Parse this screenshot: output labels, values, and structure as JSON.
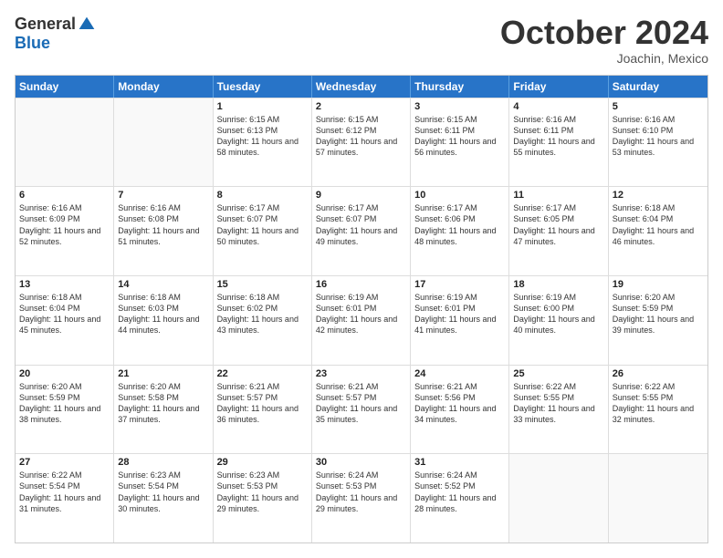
{
  "logo": {
    "general": "General",
    "blue": "Blue"
  },
  "title": "October 2024",
  "location": "Joachin, Mexico",
  "days": [
    "Sunday",
    "Monday",
    "Tuesday",
    "Wednesday",
    "Thursday",
    "Friday",
    "Saturday"
  ],
  "weeks": [
    [
      {
        "day": "",
        "sunrise": "",
        "sunset": "",
        "daylight": "",
        "empty": true
      },
      {
        "day": "",
        "sunrise": "",
        "sunset": "",
        "daylight": "",
        "empty": true
      },
      {
        "day": "1",
        "sunrise": "Sunrise: 6:15 AM",
        "sunset": "Sunset: 6:13 PM",
        "daylight": "Daylight: 11 hours and 58 minutes."
      },
      {
        "day": "2",
        "sunrise": "Sunrise: 6:15 AM",
        "sunset": "Sunset: 6:12 PM",
        "daylight": "Daylight: 11 hours and 57 minutes."
      },
      {
        "day": "3",
        "sunrise": "Sunrise: 6:15 AM",
        "sunset": "Sunset: 6:11 PM",
        "daylight": "Daylight: 11 hours and 56 minutes."
      },
      {
        "day": "4",
        "sunrise": "Sunrise: 6:16 AM",
        "sunset": "Sunset: 6:11 PM",
        "daylight": "Daylight: 11 hours and 55 minutes."
      },
      {
        "day": "5",
        "sunrise": "Sunrise: 6:16 AM",
        "sunset": "Sunset: 6:10 PM",
        "daylight": "Daylight: 11 hours and 53 minutes."
      }
    ],
    [
      {
        "day": "6",
        "sunrise": "Sunrise: 6:16 AM",
        "sunset": "Sunset: 6:09 PM",
        "daylight": "Daylight: 11 hours and 52 minutes."
      },
      {
        "day": "7",
        "sunrise": "Sunrise: 6:16 AM",
        "sunset": "Sunset: 6:08 PM",
        "daylight": "Daylight: 11 hours and 51 minutes."
      },
      {
        "day": "8",
        "sunrise": "Sunrise: 6:17 AM",
        "sunset": "Sunset: 6:07 PM",
        "daylight": "Daylight: 11 hours and 50 minutes."
      },
      {
        "day": "9",
        "sunrise": "Sunrise: 6:17 AM",
        "sunset": "Sunset: 6:07 PM",
        "daylight": "Daylight: 11 hours and 49 minutes."
      },
      {
        "day": "10",
        "sunrise": "Sunrise: 6:17 AM",
        "sunset": "Sunset: 6:06 PM",
        "daylight": "Daylight: 11 hours and 48 minutes."
      },
      {
        "day": "11",
        "sunrise": "Sunrise: 6:17 AM",
        "sunset": "Sunset: 6:05 PM",
        "daylight": "Daylight: 11 hours and 47 minutes."
      },
      {
        "day": "12",
        "sunrise": "Sunrise: 6:18 AM",
        "sunset": "Sunset: 6:04 PM",
        "daylight": "Daylight: 11 hours and 46 minutes."
      }
    ],
    [
      {
        "day": "13",
        "sunrise": "Sunrise: 6:18 AM",
        "sunset": "Sunset: 6:04 PM",
        "daylight": "Daylight: 11 hours and 45 minutes."
      },
      {
        "day": "14",
        "sunrise": "Sunrise: 6:18 AM",
        "sunset": "Sunset: 6:03 PM",
        "daylight": "Daylight: 11 hours and 44 minutes."
      },
      {
        "day": "15",
        "sunrise": "Sunrise: 6:18 AM",
        "sunset": "Sunset: 6:02 PM",
        "daylight": "Daylight: 11 hours and 43 minutes."
      },
      {
        "day": "16",
        "sunrise": "Sunrise: 6:19 AM",
        "sunset": "Sunset: 6:01 PM",
        "daylight": "Daylight: 11 hours and 42 minutes."
      },
      {
        "day": "17",
        "sunrise": "Sunrise: 6:19 AM",
        "sunset": "Sunset: 6:01 PM",
        "daylight": "Daylight: 11 hours and 41 minutes."
      },
      {
        "day": "18",
        "sunrise": "Sunrise: 6:19 AM",
        "sunset": "Sunset: 6:00 PM",
        "daylight": "Daylight: 11 hours and 40 minutes."
      },
      {
        "day": "19",
        "sunrise": "Sunrise: 6:20 AM",
        "sunset": "Sunset: 5:59 PM",
        "daylight": "Daylight: 11 hours and 39 minutes."
      }
    ],
    [
      {
        "day": "20",
        "sunrise": "Sunrise: 6:20 AM",
        "sunset": "Sunset: 5:59 PM",
        "daylight": "Daylight: 11 hours and 38 minutes."
      },
      {
        "day": "21",
        "sunrise": "Sunrise: 6:20 AM",
        "sunset": "Sunset: 5:58 PM",
        "daylight": "Daylight: 11 hours and 37 minutes."
      },
      {
        "day": "22",
        "sunrise": "Sunrise: 6:21 AM",
        "sunset": "Sunset: 5:57 PM",
        "daylight": "Daylight: 11 hours and 36 minutes."
      },
      {
        "day": "23",
        "sunrise": "Sunrise: 6:21 AM",
        "sunset": "Sunset: 5:57 PM",
        "daylight": "Daylight: 11 hours and 35 minutes."
      },
      {
        "day": "24",
        "sunrise": "Sunrise: 6:21 AM",
        "sunset": "Sunset: 5:56 PM",
        "daylight": "Daylight: 11 hours and 34 minutes."
      },
      {
        "day": "25",
        "sunrise": "Sunrise: 6:22 AM",
        "sunset": "Sunset: 5:55 PM",
        "daylight": "Daylight: 11 hours and 33 minutes."
      },
      {
        "day": "26",
        "sunrise": "Sunrise: 6:22 AM",
        "sunset": "Sunset: 5:55 PM",
        "daylight": "Daylight: 11 hours and 32 minutes."
      }
    ],
    [
      {
        "day": "27",
        "sunrise": "Sunrise: 6:22 AM",
        "sunset": "Sunset: 5:54 PM",
        "daylight": "Daylight: 11 hours and 31 minutes."
      },
      {
        "day": "28",
        "sunrise": "Sunrise: 6:23 AM",
        "sunset": "Sunset: 5:54 PM",
        "daylight": "Daylight: 11 hours and 30 minutes."
      },
      {
        "day": "29",
        "sunrise": "Sunrise: 6:23 AM",
        "sunset": "Sunset: 5:53 PM",
        "daylight": "Daylight: 11 hours and 29 minutes."
      },
      {
        "day": "30",
        "sunrise": "Sunrise: 6:24 AM",
        "sunset": "Sunset: 5:53 PM",
        "daylight": "Daylight: 11 hours and 29 minutes."
      },
      {
        "day": "31",
        "sunrise": "Sunrise: 6:24 AM",
        "sunset": "Sunset: 5:52 PM",
        "daylight": "Daylight: 11 hours and 28 minutes."
      },
      {
        "day": "",
        "sunrise": "",
        "sunset": "",
        "daylight": "",
        "empty": true
      },
      {
        "day": "",
        "sunrise": "",
        "sunset": "",
        "daylight": "",
        "empty": true
      }
    ]
  ]
}
